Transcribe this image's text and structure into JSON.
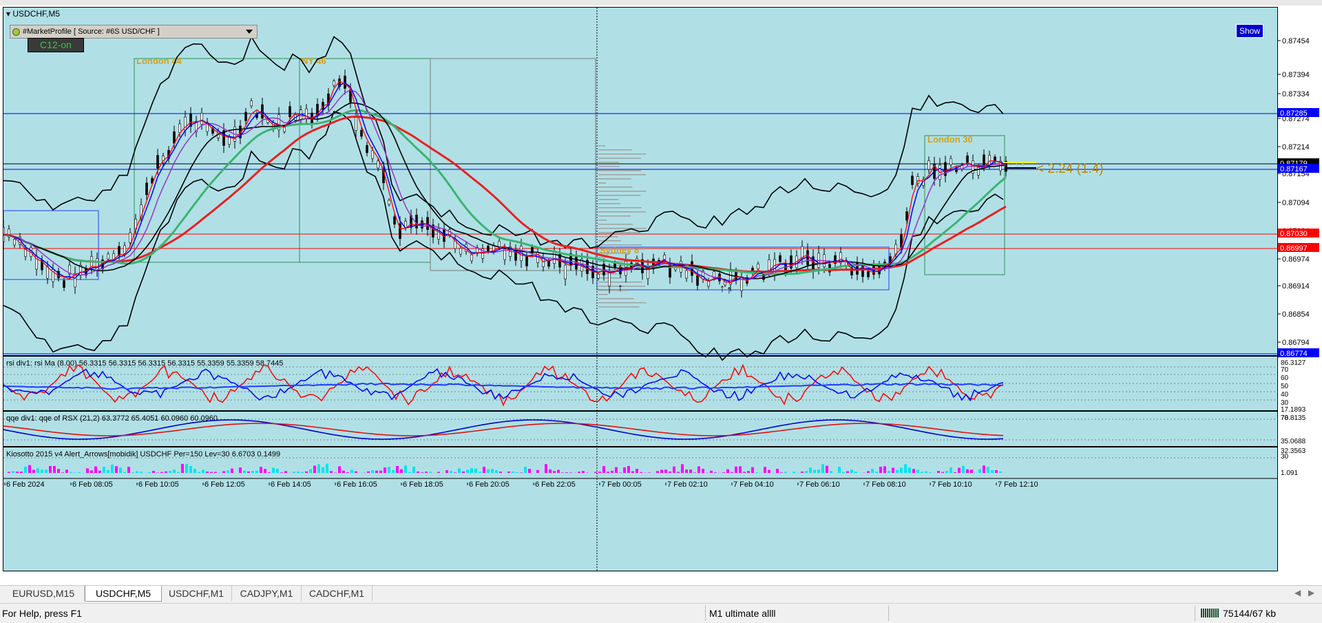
{
  "chart_title": "USDCHF,M5",
  "market_profile": {
    "label": "#MarketProfile [ Source: #6S USD/CHF ]"
  },
  "c12_button": "C12-on",
  "show_button": "Show",
  "session_boxes": [
    {
      "label": "London 44",
      "color": "#d4a017"
    },
    {
      "label": "NY 46",
      "color": "#d4a017"
    },
    {
      "label": "Sydney 8",
      "color": "#d4a017"
    },
    {
      "label": "London 30",
      "color": "#d4a017"
    }
  ],
  "annotation": {
    "label": "2.24 (1.4)",
    "small_label": "1.4"
  },
  "price_scale": {
    "ticks": [
      "0.87454",
      "0.87394",
      "0.87334",
      "0.87274",
      "0.87214",
      "0.87154",
      "0.87094",
      "0.87034",
      "0.86974",
      "0.86914",
      "0.86854",
      "0.86794"
    ],
    "tags": [
      {
        "value": "0.87285",
        "bg": "#0000ff"
      },
      {
        "value": "0.87179",
        "bg": "#000000"
      },
      {
        "value": "0.87167",
        "bg": "#0000ff"
      },
      {
        "value": "0.87030",
        "bg": "#ff0000"
      },
      {
        "value": "0.86997",
        "bg": "#ff0000"
      },
      {
        "value": "0.86774",
        "bg": "#0000ff"
      }
    ]
  },
  "rsi_panel": {
    "label": "rsi div1: rsi Ma (8.00) 56.3315 56.3315 56.3315 56.3315 55.3359 55.3359 58.7445",
    "scale": [
      "86.3127",
      "70",
      "60",
      "50",
      "40",
      "30",
      "17.1893"
    ]
  },
  "qqe_panel": {
    "label": "qqe div1: qqe of RSX (21,2) 63.3772 65.4051 60.0960 60.0960",
    "scale": [
      "78.8135",
      "70",
      "35.0688"
    ]
  },
  "kiosotto_panel": {
    "label": "Kiosotto 2015 v4 Alert_Arrows[mobidik] USDCHF Per=150 Lev=30 6.6703 0.1499",
    "scale": [
      "32.3563",
      "30",
      "1.091"
    ]
  },
  "time_axis": [
    "6 Feb 2024",
    "6 Feb 08:05",
    "6 Feb 10:05",
    "6 Feb 12:05",
    "6 Feb 14:05",
    "6 Feb 16:05",
    "6 Feb 18:05",
    "6 Feb 20:05",
    "6 Feb 22:05",
    "7 Feb 00:05",
    "7 Feb 02:10",
    "7 Feb 04:10",
    "7 Feb 06:10",
    "7 Feb 08:10",
    "7 Feb 10:10",
    "7 Feb 12:10"
  ],
  "tabs": [
    {
      "label": "EURUSD,M15",
      "active": false
    },
    {
      "label": "USDCHF,M5",
      "active": true
    },
    {
      "label": "USDCHF,M1",
      "active": false
    },
    {
      "label": "CADJPY,M1",
      "active": false
    },
    {
      "label": "CADCHF,M1",
      "active": false
    }
  ],
  "status": {
    "help": "For Help, press F1",
    "profile": "M1 ultimate allll",
    "traffic": "75144/67 kb"
  }
}
